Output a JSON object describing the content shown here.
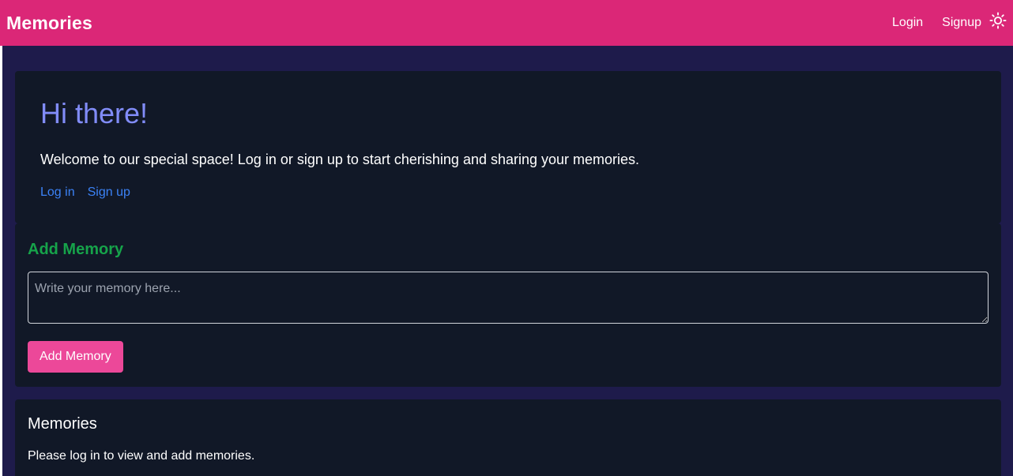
{
  "navbar": {
    "brand": "Memories",
    "login_label": "Login",
    "signup_label": "Signup",
    "theme_icon": "sun-icon"
  },
  "hero": {
    "title": "Hi there!",
    "text": "Welcome to our special space! Log in or sign up to start cherishing and sharing your memories.",
    "login_link": "Log in",
    "signup_link": "Sign up"
  },
  "add_memory": {
    "title": "Add Memory",
    "placeholder": "Write your memory here...",
    "button_label": "Add Memory"
  },
  "memories": {
    "title": "Memories",
    "empty_text": "Please log in to view and add memories."
  },
  "colors": {
    "navbar": "#db2777",
    "page_bg": "#1e1b4b",
    "card_bg": "#111827",
    "hero_title": "#818cf8",
    "link": "#3b82f6",
    "add_title": "#16a34a",
    "button": "#ec4899"
  }
}
